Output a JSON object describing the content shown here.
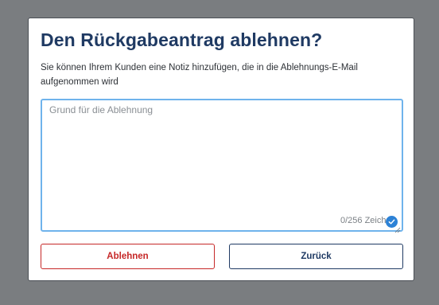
{
  "dialog": {
    "title": "Den Rückgabeantrag ablehnen?",
    "description": "Sie können Ihrem Kunden eine Notiz hinzufügen, die in die Ablehnungs-E-Mail aufgenommen wird",
    "reason_field": {
      "value": "",
      "placeholder": "Grund für die Ablehnung",
      "counter": "0/256 Zeichen"
    },
    "buttons": {
      "reject_label": "Ablehnen",
      "back_label": "Zurück"
    }
  },
  "colors": {
    "overlay": "#7a7d80",
    "title": "#1f3a63",
    "focus_border": "#6fb3ec",
    "reject": "#c62828",
    "back": "#1f3a63",
    "check_badge": "#2d82d6"
  },
  "icons": {
    "field_status": "check-circle-icon",
    "resize": "resize-handle-icon"
  }
}
